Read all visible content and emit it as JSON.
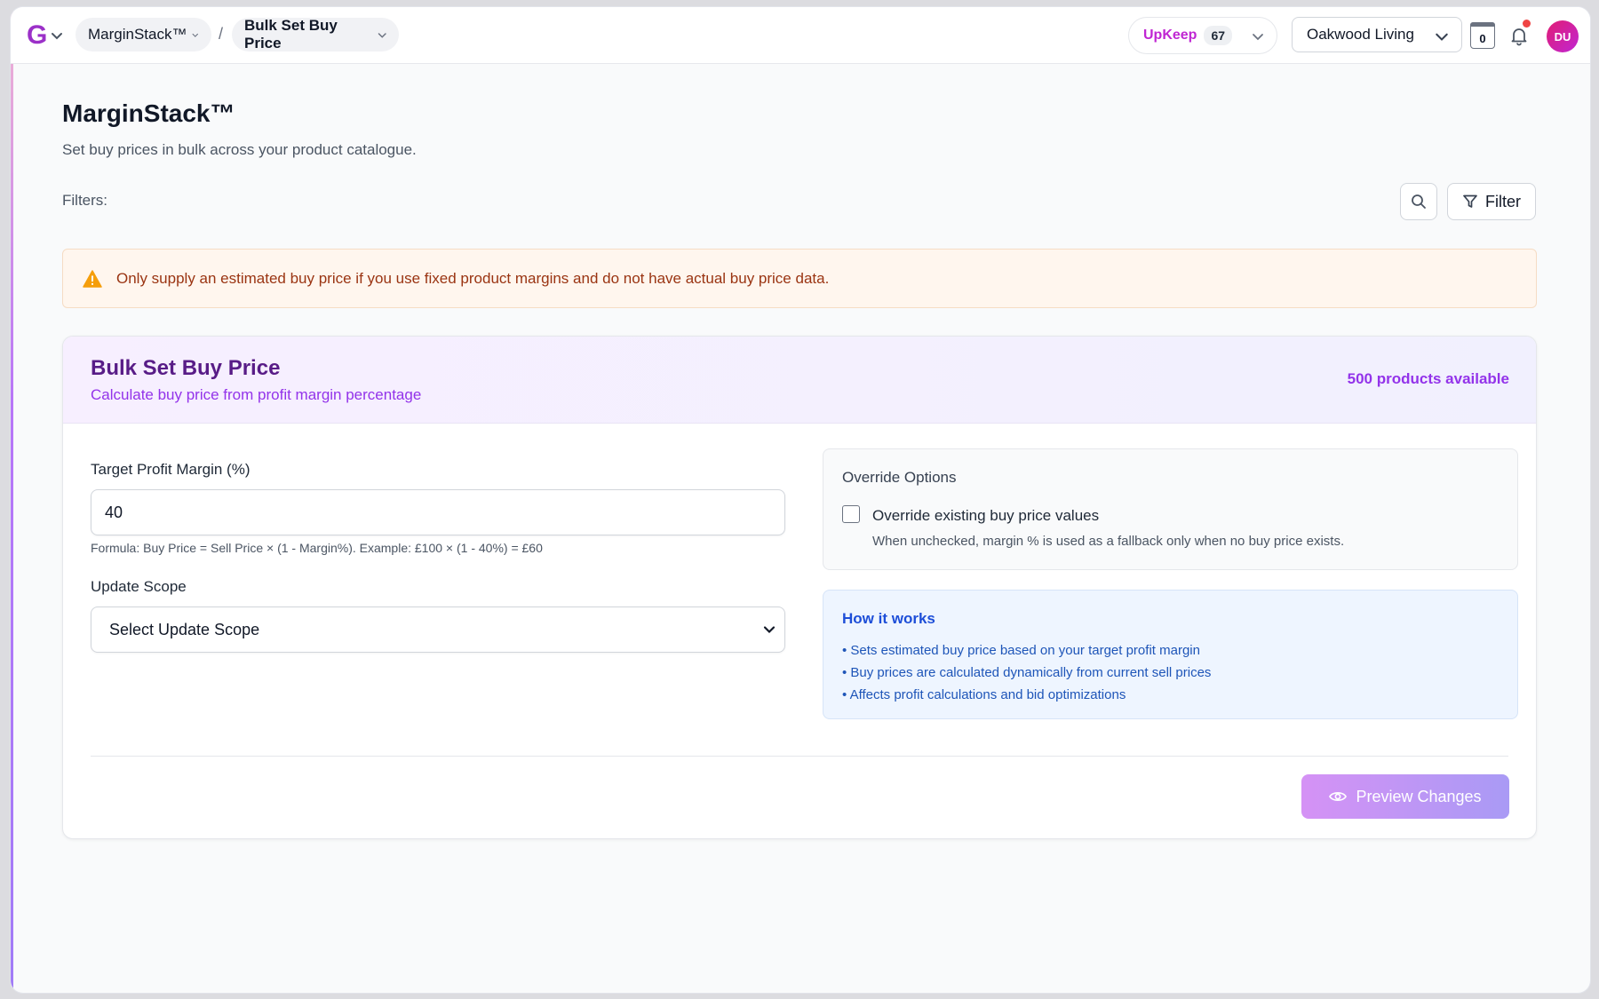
{
  "topbar": {
    "logo_letter": "G",
    "app_switcher": "MarginStack™",
    "separator": "/",
    "current_page": "Bulk Set Buy Price",
    "upkeep": {
      "label": "UpKeep",
      "count": "67"
    },
    "store": "Oakwood Living",
    "counter_value": "0",
    "avatar_initials": "DU"
  },
  "header": {
    "title": "MarginStack™",
    "subtitle": "Set buy prices in bulk across your product catalogue.",
    "filters_label": "Filters:",
    "filter_button": "Filter"
  },
  "alert": {
    "text": "Only supply an estimated buy price if you use fixed product margins and do not have actual buy price data."
  },
  "card": {
    "title": "Bulk Set Buy Price",
    "subtitle": "Calculate buy price from profit margin percentage",
    "available": "500 products available",
    "margin_label": "Target Profit Margin (%)",
    "margin_value": "40",
    "formula_hint": "Formula: Buy Price = Sell Price × (1 - Margin%). Example: £100 × (1 - 40%) = £60",
    "scope_label": "Update Scope",
    "scope_selected": "Select Update Scope",
    "override": {
      "title": "Override Options",
      "checkbox_label": "Override existing buy price values",
      "note": "When unchecked, margin % is used as a fallback only when no buy price exists."
    },
    "how": {
      "title": "How it works",
      "items": [
        "• Sets estimated buy price based on your target profit margin",
        "• Buy prices are calculated dynamically from current sell prices",
        "• Affects profit calculations and bid optimizations"
      ]
    },
    "preview_button": "Preview Changes"
  },
  "colors": {
    "brand": "#9b30c8",
    "accent_purple": "#9333ea",
    "alert_text": "#9a3412",
    "info_blue": "#1d4ed8"
  },
  "icons": {
    "chevron": "chevron-down-icon",
    "search": "search-icon",
    "filter": "filter-icon",
    "warning": "warning-icon",
    "bell": "bell-icon",
    "eye": "eye-icon"
  }
}
